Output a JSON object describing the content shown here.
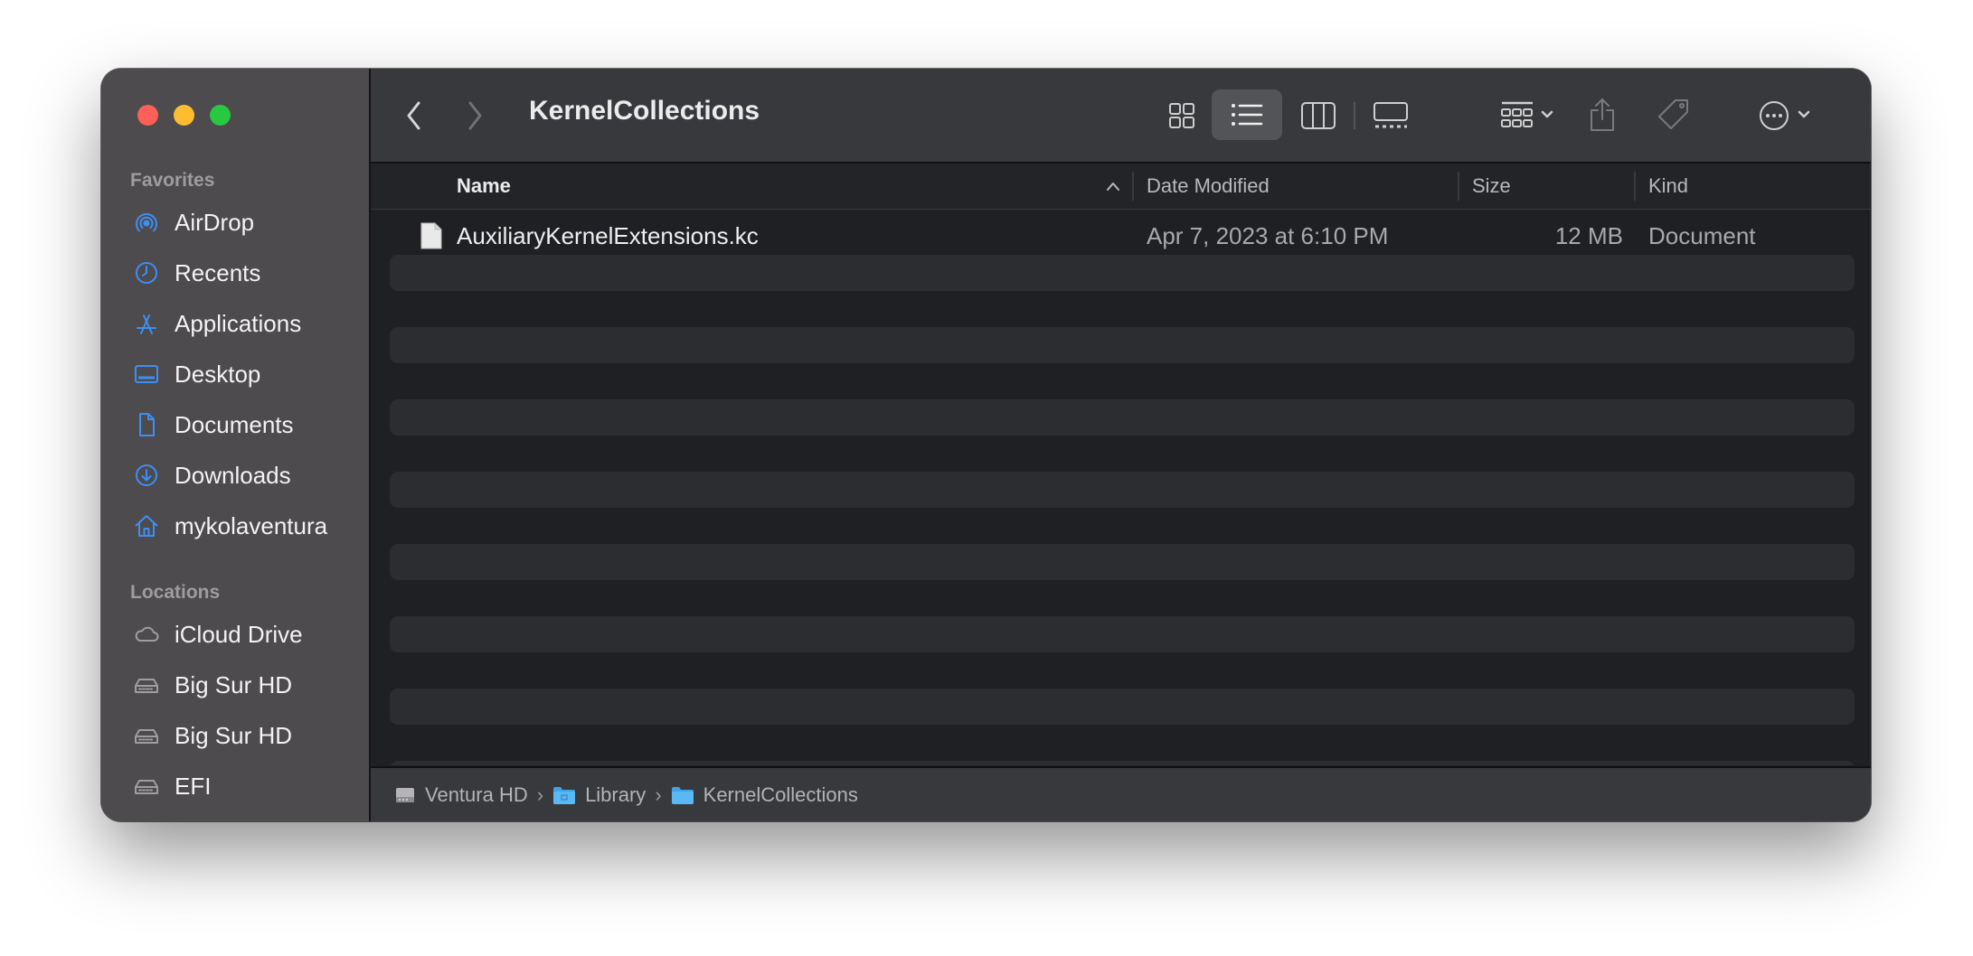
{
  "window": {
    "title": "KernelCollections"
  },
  "sidebar": {
    "favorites_title": "Favorites",
    "favorites": [
      {
        "label": "AirDrop",
        "icon": "airdrop-icon"
      },
      {
        "label": "Recents",
        "icon": "clock-icon"
      },
      {
        "label": "Applications",
        "icon": "applications-icon"
      },
      {
        "label": "Desktop",
        "icon": "desktop-icon"
      },
      {
        "label": "Documents",
        "icon": "document-icon"
      },
      {
        "label": "Downloads",
        "icon": "download-icon"
      },
      {
        "label": "mykolaventura",
        "icon": "home-icon"
      }
    ],
    "locations_title": "Locations",
    "locations": [
      {
        "label": "iCloud Drive",
        "icon": "cloud-icon"
      },
      {
        "label": "Big Sur HD",
        "icon": "drive-icon"
      },
      {
        "label": "Big Sur HD",
        "icon": "drive-icon"
      },
      {
        "label": "EFI",
        "icon": "drive-icon"
      }
    ]
  },
  "toolbar": {
    "view_mode": "list"
  },
  "columns": {
    "name": "Name",
    "date": "Date Modified",
    "size": "Size",
    "kind": "Kind",
    "sort": "name-ascending"
  },
  "files": [
    {
      "name": "AuxiliaryKernelExtensions.kc",
      "date": "Apr 7, 2023 at 6:10 PM",
      "size": "12 MB",
      "kind": "Document",
      "icon": "file-icon"
    }
  ],
  "pathbar": [
    {
      "label": "Ventura HD",
      "icon": "drive-icon"
    },
    {
      "label": "Library",
      "icon": "folder-icon"
    },
    {
      "label": "KernelCollections",
      "icon": "folder-icon"
    }
  ],
  "colors": {
    "accent": "#3d8ff5",
    "close": "#fe5f57",
    "minimize": "#febc2e",
    "maximize": "#28c840"
  }
}
